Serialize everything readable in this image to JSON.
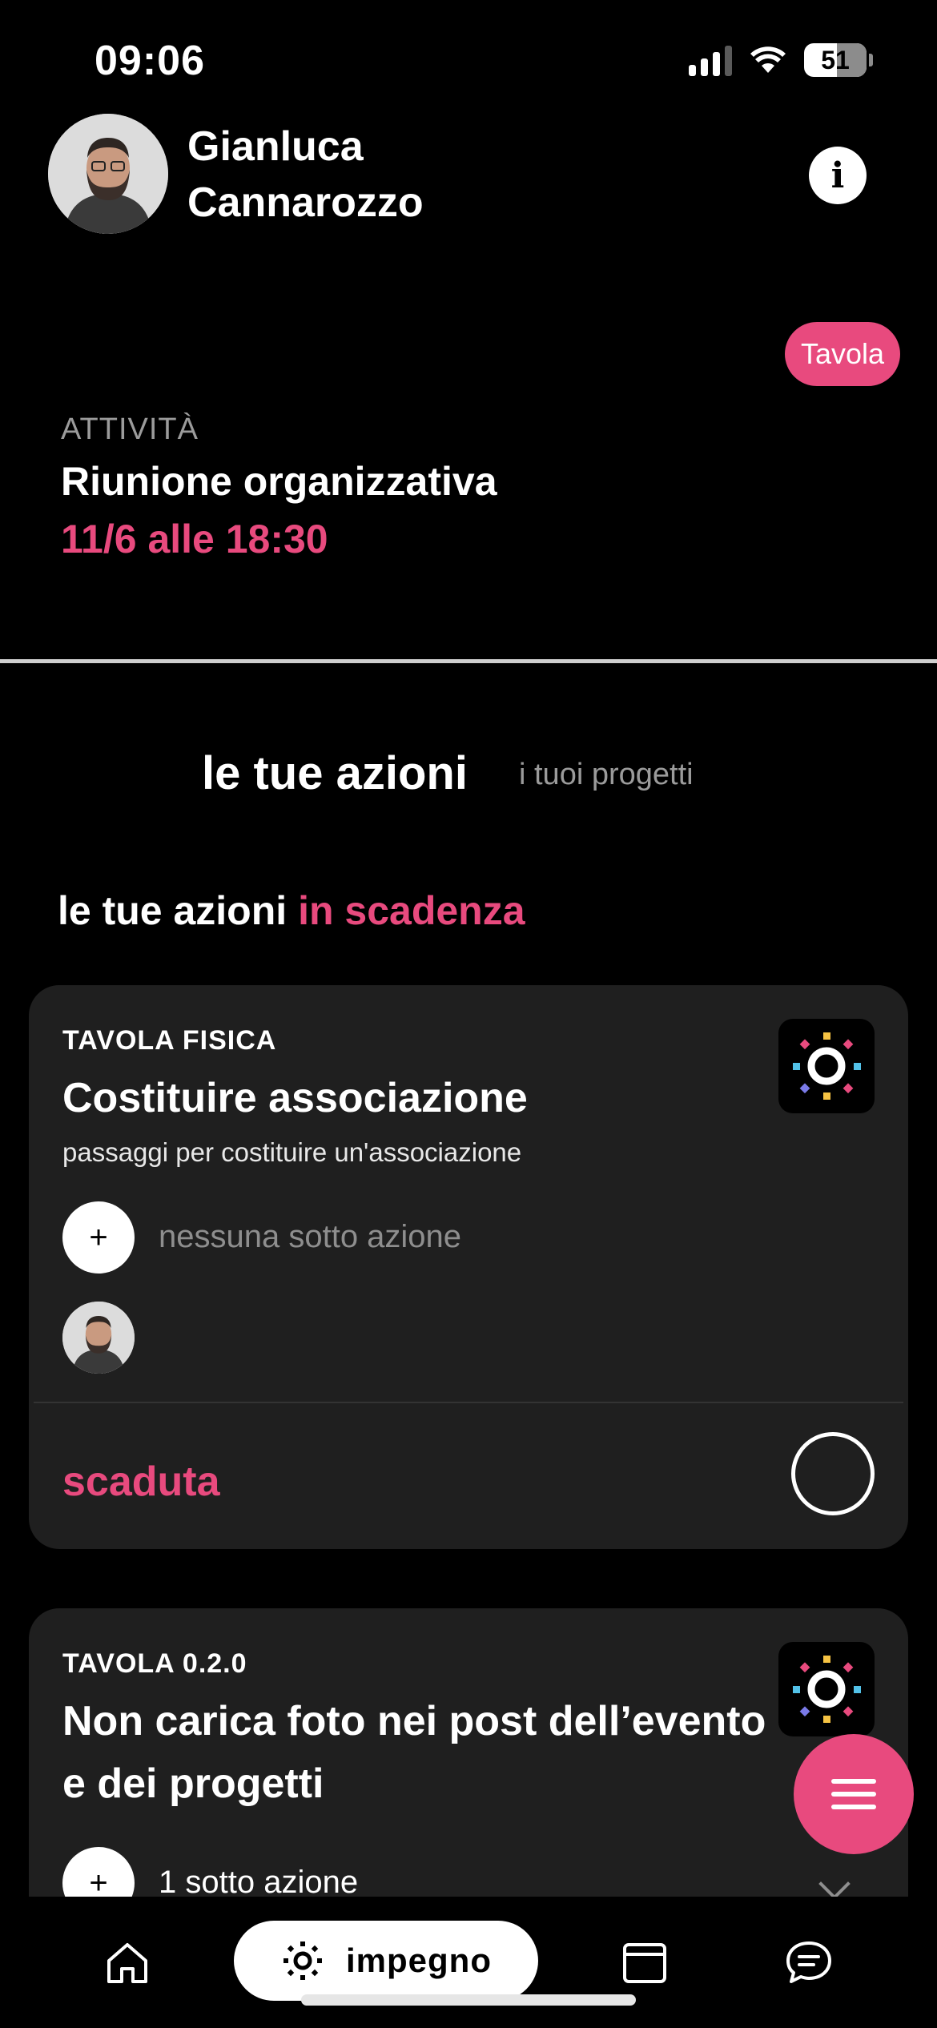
{
  "status_bar": {
    "time": "09:06",
    "battery": "51"
  },
  "header": {
    "user_name": "Gianluca Cannarozzo",
    "tag": "Tavola"
  },
  "activity": {
    "label": "ATTIVITÀ",
    "title": "Riunione organizzativa",
    "date": "11/6 alle 18:30"
  },
  "tabs": {
    "active": "le tue azioni",
    "inactive": "i tuoi progetti"
  },
  "section": {
    "title_prefix": "le tue azioni",
    "title_accent": "in scadenza"
  },
  "cards": [
    {
      "project": "TAVOLA FISICA",
      "title": "Costituire associazione",
      "description": "passaggi per costituire un'associazione",
      "sub_actions": "nessuna sotto azione",
      "status": "scaduta"
    },
    {
      "project": "TAVOLA 0.2.0",
      "title": "Non carica foto nei post dell’evento e dei progetti",
      "sub_actions": "1 sotto azione"
    }
  ],
  "bottom_nav": {
    "center_label": "impegno"
  },
  "colors": {
    "accent": "#e84a7e",
    "background": "#000000",
    "card": "#1f1f1f"
  },
  "icons": [
    "wifi-icon",
    "info-icon",
    "plus-icon",
    "menu-icon",
    "home-icon",
    "sun-icon",
    "calendar-icon",
    "chat-icon",
    "chevron-down-icon"
  ]
}
